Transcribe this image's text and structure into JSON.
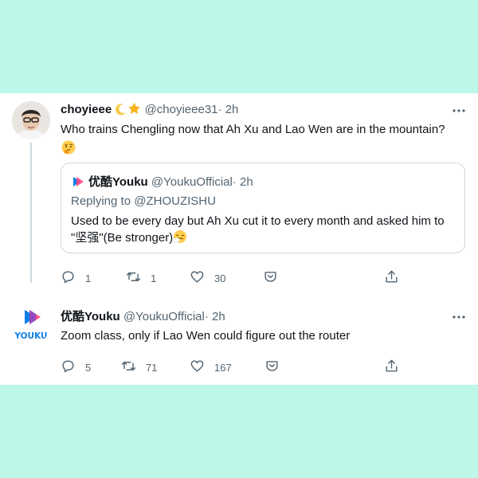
{
  "tweet1": {
    "name": "choyieee",
    "handle": "@choyieee31",
    "dot": "·",
    "time": "2h",
    "text": "Who trains Chengling now that Ah Xu and Lao Wen are in the mountain?",
    "actions": {
      "reply_count": "1",
      "retweet_count": "1",
      "like_count": "30"
    }
  },
  "quote": {
    "name": "优酷Youku",
    "handle": "@YoukuOfficial",
    "dot": "·",
    "time": "2h",
    "replying_prefix": "Replying to",
    "replying_to": "@ZHOUZISHU",
    "text": "Used to be every day but Ah Xu cut it to every month and asked him to \"坚强\"(Be stronger)"
  },
  "tweet2": {
    "name": "优酷Youku",
    "handle": "@YoukuOfficial",
    "dot": "·",
    "time": "2h",
    "text": "Zoom class, only if Lao Wen could figure out the router",
    "logo_text": "YOUKU",
    "actions": {
      "reply_count": "5",
      "retweet_count": "71",
      "like_count": "167"
    }
  },
  "colors": {
    "background": "#bdf7ea",
    "card": "#ffffff",
    "secondary_text": "#536471",
    "border": "#cfd9de",
    "youku_blue": "#0b7fe6",
    "youku_pink": "#ff3d7f"
  },
  "icons": [
    "more-icon",
    "reply-icon",
    "retweet-icon",
    "like-icon",
    "bookmark-icon",
    "share-icon",
    "moon-emoji",
    "star-emoji",
    "thinking-emoji",
    "sneezing-emoji",
    "youku-logo"
  ]
}
